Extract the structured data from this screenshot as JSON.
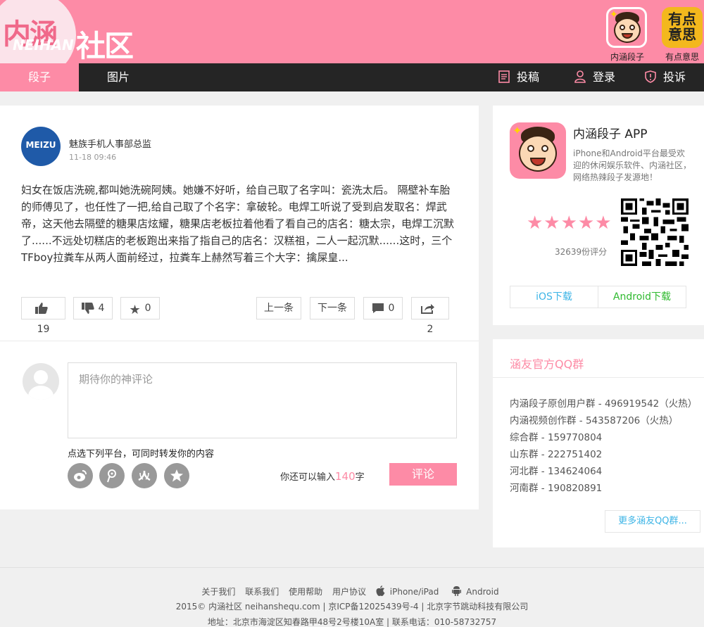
{
  "header": {
    "logo_main": "内涵",
    "logo_sub": "NEIHAN",
    "logo_side": "社区",
    "apps": [
      {
        "label": "内涵段子",
        "icon": "neihan-face-icon"
      },
      {
        "label": "有点意思",
        "icon": "youdian-icon",
        "icon_text": "有点意思"
      }
    ]
  },
  "nav": {
    "tabs": [
      "段子",
      "图片"
    ],
    "actions": [
      {
        "label": "投稿",
        "icon": "submit-doc-icon"
      },
      {
        "label": "登录",
        "icon": "user-icon"
      },
      {
        "label": "投诉",
        "icon": "report-shield-icon"
      }
    ]
  },
  "post": {
    "avatar_text": "MEIZU",
    "author": "魅族手机人事部总监",
    "time": "11-18 09:46",
    "content": "妇女在饭店洗碗,都叫她洗碗阿姨。她嫌不好听，给自己取了名字叫：瓷洗太后。 隔壁补车胎的师傅见了，也任性了一把,给自己取了个名字：拿破轮。电焊工听说了受到启发取名：焊武帝，这天他去隔壁的糖果店炫耀，糖果店老板拉着他看了看自己的店名：糖太宗，电焊工沉默了......不远处切糕店的老板跑出来指了指自己的店名：汉糕祖，二人一起沉默......这时，三个TFboy拉粪车从两人面前经过，拉粪车上赫然写着三个大字：擒屎皇...",
    "likes": "19",
    "dislikes": "4",
    "favorites": "0",
    "prev_label": "上一条",
    "next_label": "下一条",
    "comments": "0",
    "shares": "2"
  },
  "comment": {
    "placeholder": "期待你的神评论",
    "share_tip": "点选下列平台，可同时转发你的内容",
    "platforms": [
      "weibo-icon",
      "tencent-weibo-icon",
      "renren-icon",
      "qzone-icon"
    ],
    "remain_prefix": "你还可以输入",
    "remain_num": "140",
    "remain_suffix": "字",
    "submit_label": "评论"
  },
  "sidebar_app": {
    "title": "内涵段子 APP",
    "desc": "iPhone和Android平台最受欢迎的休闲娱乐软件、内涵社区，网络热辣段子发源地！",
    "rating_stars": 5,
    "stars_text": "★★★★★",
    "rating_text": "32639份评分",
    "ios_label": "iOS下载",
    "android_label": "Android下载"
  },
  "sidebar_qq": {
    "title": "涵友官方QQ群",
    "groups": [
      "内涵段子原创用户群 - 496919542（火热）",
      "内涵视频创作群 - 543587206（火热）",
      "综合群 - 159770804",
      "山东群 - 222751402",
      "河北群 - 134624064",
      "河南群 - 190820891"
    ],
    "more_label": "更多涵友QQ群..."
  },
  "footer": {
    "links": [
      "关于我们",
      "联系我们",
      "使用帮助",
      "用户协议",
      "iPhone/iPad",
      "Android"
    ],
    "copyright": "2015© 内涵社区 neihanshequ.com | 京ICP备12025439号-4 | 北京字节跳动科技有限公司",
    "address": "地址：北京市海淀区知春路甲48号2号楼10A室 | 联系电话：010-58732757"
  },
  "colors": {
    "accent": "#fd8ba6",
    "nav_bg": "#252525"
  }
}
